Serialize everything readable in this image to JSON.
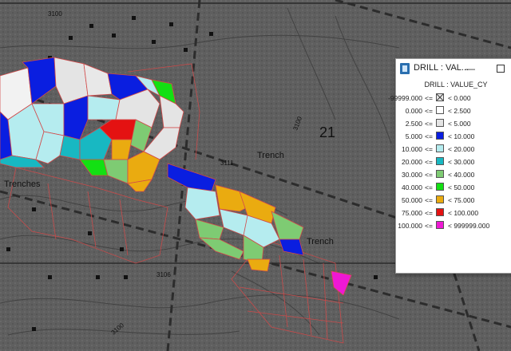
{
  "window": {
    "title": "DRILL : VAL...",
    "minimize_glyph": "—",
    "maximize_icon": "maximize-icon",
    "app_icon": "map-layer-icon"
  },
  "legend": {
    "heading": "DRILL : VALUE_CY",
    "rows": [
      {
        "low": "-99999.000",
        "op": "<=",
        "high": "< 0.000",
        "color": "nodata"
      },
      {
        "low": "0.000",
        "op": "<=",
        "high": "< 2.500",
        "color": "#ffffff"
      },
      {
        "low": "2.500",
        "op": "<=",
        "high": "< 5.000",
        "color": "#e4e4e4"
      },
      {
        "low": "5.000",
        "op": "<=",
        "high": "< 10.000",
        "color": "#0a1ee0"
      },
      {
        "low": "10.000",
        "op": "<=",
        "high": "< 20.000",
        "color": "#b5ecef"
      },
      {
        "low": "20.000",
        "op": "<=",
        "high": "< 30.000",
        "color": "#18b8c2"
      },
      {
        "low": "30.000",
        "op": "<=",
        "high": "< 40.000",
        "color": "#7ecb73"
      },
      {
        "low": "40.000",
        "op": "<=",
        "high": "< 50.000",
        "color": "#13e013"
      },
      {
        "low": "50.000",
        "op": "<=",
        "high": "< 75.000",
        "color": "#eaab10"
      },
      {
        "low": "75.000",
        "op": "<=",
        "high": "< 100.000",
        "color": "#e41212"
      },
      {
        "low": "100.000",
        "op": "<=",
        "high": "< 999999.000",
        "color": "#ee18d4"
      }
    ]
  },
  "map_labels": {
    "section": "21",
    "trench_1": "Trench",
    "trench_2": "Trench",
    "trenches": "Trenches",
    "elev_1": "3111",
    "elev_2": "3106",
    "elev_3": "3100",
    "elev_4": "3100",
    "elev_5": "3100"
  }
}
